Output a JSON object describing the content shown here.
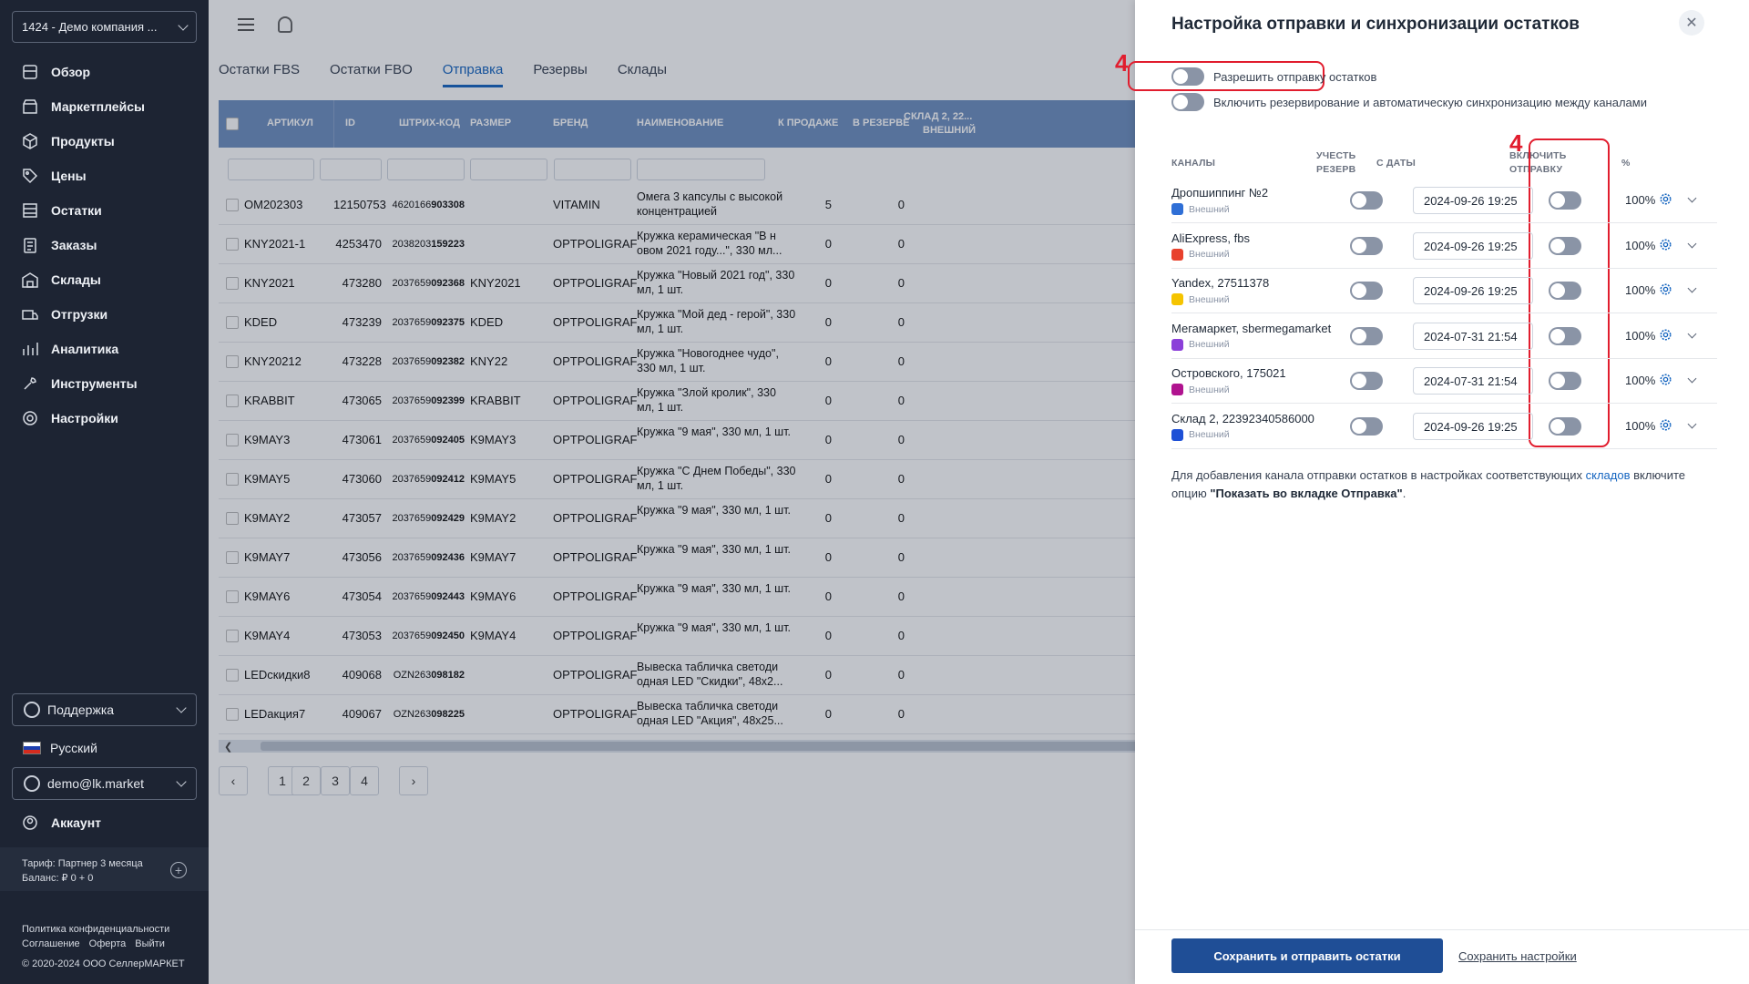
{
  "sidebar": {
    "company": "1424 - Демо компания ...",
    "nav": [
      {
        "label": "Обзор",
        "icon": "overview-icon"
      },
      {
        "label": "Маркетплейсы",
        "icon": "marketplaces-icon"
      },
      {
        "label": "Продукты",
        "icon": "products-icon"
      },
      {
        "label": "Цены",
        "icon": "prices-icon"
      },
      {
        "label": "Остатки",
        "icon": "stocks-icon"
      },
      {
        "label": "Заказы",
        "icon": "orders-icon"
      },
      {
        "label": "Склады",
        "icon": "warehouses-icon"
      },
      {
        "label": "Отгрузки",
        "icon": "shipments-icon"
      },
      {
        "label": "Аналитика",
        "icon": "analytics-icon"
      },
      {
        "label": "Инструменты",
        "icon": "tools-icon"
      },
      {
        "label": "Настройки",
        "icon": "settings-icon"
      }
    ],
    "support": "Поддержка",
    "language": "Русский",
    "user": "demo@lk.market",
    "account": "Аккаунт",
    "tariff": "Тариф: Партнер 3 месяца",
    "balance": "Баланс: ₽ 0 + 0",
    "links": {
      "privacy": "Политика конфиденциальности",
      "agreement": "Соглашение",
      "offer": "Оферта",
      "logout": "Выйти"
    },
    "copyright": "© 2020-2024 ООО СеллерМАРКЕТ"
  },
  "tabs": [
    "Остатки FBS",
    "Остатки FBO",
    "Отправка",
    "Резервы",
    "Склады"
  ],
  "active_tab": "Отправка",
  "table": {
    "headers": {
      "article": "АРТИКУЛ",
      "id": "ID",
      "barcode": "ШТРИХ-КОД",
      "size": "РАЗМЕР",
      "brand": "БРЕНД",
      "name": "НАИМЕНОВАНИЕ",
      "for_sale": "К ПРОДАЖЕ",
      "reserved": "В РЕЗЕРВЕ",
      "warehouse": "СКЛАД 2, 22...",
      "warehouse_sub": "ВНЕШНИЙ"
    },
    "rows": [
      {
        "article": "OM202303",
        "id": "12150753",
        "bc_pre": "4620166",
        "bc_bold": "903308",
        "size": "",
        "brand": "VITAMIN",
        "name": "Омега 3 капсулы с высокой концентрацией",
        "for_sale": "5",
        "reserved": "0"
      },
      {
        "article": "KNY2021-1",
        "id": "4253470",
        "bc_pre": "2038203",
        "bc_bold": "159223",
        "size": "",
        "brand": "OPTPOLIGRAF",
        "name": "Кружка керамическая \"В н овом 2021 году...\", 330 мл...",
        "for_sale": "0",
        "reserved": "0"
      },
      {
        "article": "KNY2021",
        "id": "473280",
        "bc_pre": "2037659",
        "bc_bold": "092368",
        "size": "KNY2021",
        "brand": "OPTPOLIGRAF",
        "name": "Кружка \"Новый 2021 год\", 330 мл, 1 шт.",
        "for_sale": "0",
        "reserved": "0"
      },
      {
        "article": "KDED",
        "id": "473239",
        "bc_pre": "2037659",
        "bc_bold": "092375",
        "size": "KDED",
        "brand": "OPTPOLIGRAF",
        "name": "Кружка \"Мой дед - герой\", 330 мл, 1 шт.",
        "for_sale": "0",
        "reserved": "0"
      },
      {
        "article": "KNY20212",
        "id": "473228",
        "bc_pre": "2037659",
        "bc_bold": "092382",
        "size": "KNY22",
        "brand": "OPTPOLIGRAF",
        "name": "Кружка \"Новогоднее чудо\", 330 мл, 1 шт.",
        "for_sale": "0",
        "reserved": "0"
      },
      {
        "article": "KRABBIT",
        "id": "473065",
        "bc_pre": "2037659",
        "bc_bold": "092399",
        "size": "KRABBIT",
        "brand": "OPTPOLIGRAF",
        "name": "Кружка \"Злой кролик\", 330 мл, 1 шт.",
        "for_sale": "0",
        "reserved": "0"
      },
      {
        "article": "K9MAY3",
        "id": "473061",
        "bc_pre": "2037659",
        "bc_bold": "092405",
        "size": "K9MAY3",
        "brand": "OPTPOLIGRAF",
        "name": "Кружка \"9 мая\", 330 мл, 1 шт.",
        "for_sale": "0",
        "reserved": "0"
      },
      {
        "article": "K9MAY5",
        "id": "473060",
        "bc_pre": "2037659",
        "bc_bold": "092412",
        "size": "K9MAY5",
        "brand": "OPTPOLIGRAF",
        "name": "Кружка \"С Днем Победы\", 330 мл, 1 шт.",
        "for_sale": "0",
        "reserved": "0"
      },
      {
        "article": "K9MAY2",
        "id": "473057",
        "bc_pre": "2037659",
        "bc_bold": "092429",
        "size": "K9MAY2",
        "brand": "OPTPOLIGRAF",
        "name": "Кружка \"9 мая\", 330 мл, 1 шт.",
        "for_sale": "0",
        "reserved": "0"
      },
      {
        "article": "K9MAY7",
        "id": "473056",
        "bc_pre": "2037659",
        "bc_bold": "092436",
        "size": "K9MAY7",
        "brand": "OPTPOLIGRAF",
        "name": "Кружка \"9 мая\", 330 мл, 1 шт.",
        "for_sale": "0",
        "reserved": "0"
      },
      {
        "article": "K9MAY6",
        "id": "473054",
        "bc_pre": "2037659",
        "bc_bold": "092443",
        "size": "K9MAY6",
        "brand": "OPTPOLIGRAF",
        "name": "Кружка \"9 мая\", 330 мл, 1 шт.",
        "for_sale": "0",
        "reserved": "0"
      },
      {
        "article": "K9MAY4",
        "id": "473053",
        "bc_pre": "2037659",
        "bc_bold": "092450",
        "size": "K9MAY4",
        "brand": "OPTPOLIGRAF",
        "name": "Кружка \"9 мая\", 330 мл, 1 шт.",
        "for_sale": "0",
        "reserved": "0"
      },
      {
        "article": "LEDскидки8",
        "id": "409068",
        "bc_pre": "OZN263",
        "bc_bold": "098182",
        "size": "",
        "brand": "OPTPOLIGRAF",
        "name": "Вывеска табличка светоди одная LED \"Скидки\", 48x2...",
        "for_sale": "0",
        "reserved": "0"
      },
      {
        "article": "LEDакция7",
        "id": "409067",
        "bc_pre": "OZN263",
        "bc_bold": "098225",
        "size": "",
        "brand": "OPTPOLIGRAF",
        "name": "Вывеска табличка светоди одная LED \"Акция\", 48x25...",
        "for_sale": "0",
        "reserved": "0"
      }
    ]
  },
  "pagination": [
    "1",
    "2",
    "3",
    "4"
  ],
  "panel": {
    "title": "Настройка отправки и синхронизации остатков",
    "allow_send_label": "Разрешить отправку остатков",
    "enable_reserve_label": "Включить резервирование и автоматическую синхронизацию между каналами",
    "annotation_marker": "4",
    "headers": {
      "channels": "КАНАЛЫ",
      "account_reserve_1": "УЧЕСТЬ",
      "account_reserve_2": "РЕЗЕРВ",
      "from_date": "С ДАТЫ",
      "enable_send_1": "ВКЛЮЧИТЬ",
      "enable_send_2": "ОТПРАВКУ",
      "percent": "%"
    },
    "channels": [
      {
        "name": "Дропшиппинг №2",
        "type": "Внешний",
        "date": "2024-09-26 19:25",
        "percent": "100%",
        "logo_color": "#2f6fd6"
      },
      {
        "name": "AliExpress, fbs",
        "type": "Внешний",
        "date": "2024-09-26 19:25",
        "percent": "100%",
        "logo_color": "#e8412c"
      },
      {
        "name": "Yandex, 27511378",
        "type": "Внешний",
        "date": "2024-09-26 19:25",
        "percent": "100%",
        "logo_color": "#f5c400"
      },
      {
        "name": "Мегамаркет, sbermegamarket",
        "type": "Внешний",
        "date": "2024-07-31 21:54",
        "percent": "100%",
        "logo_color": "#8b3fd9"
      },
      {
        "name": "Островского, 175021",
        "type": "Внешний",
        "date": "2024-07-31 21:54",
        "percent": "100%",
        "logo_color": "#b0138f"
      },
      {
        "name": "Склад 2, 22392340586000",
        "type": "Внешний",
        "date": "2024-09-26 19:25",
        "percent": "100%",
        "logo_color": "#1e50d6"
      }
    ],
    "note_text_1": "Для добавления канала отправки остатков в настройках соответствующих",
    "note_link": "складов",
    "note_text_2": "включите опцию",
    "note_bold": "\"Показать во вкладке Отправка\"",
    "note_end": ".",
    "save_send_button": "Сохранить и отправить остатки",
    "save_settings_link": "Сохранить настройки"
  },
  "colors": {
    "sidebar_bg": "#1d2433",
    "accent": "#1565c0",
    "primary_button": "#1f4e96",
    "annotation_red": "#e11d2e",
    "table_header": "#6e8fc0"
  }
}
